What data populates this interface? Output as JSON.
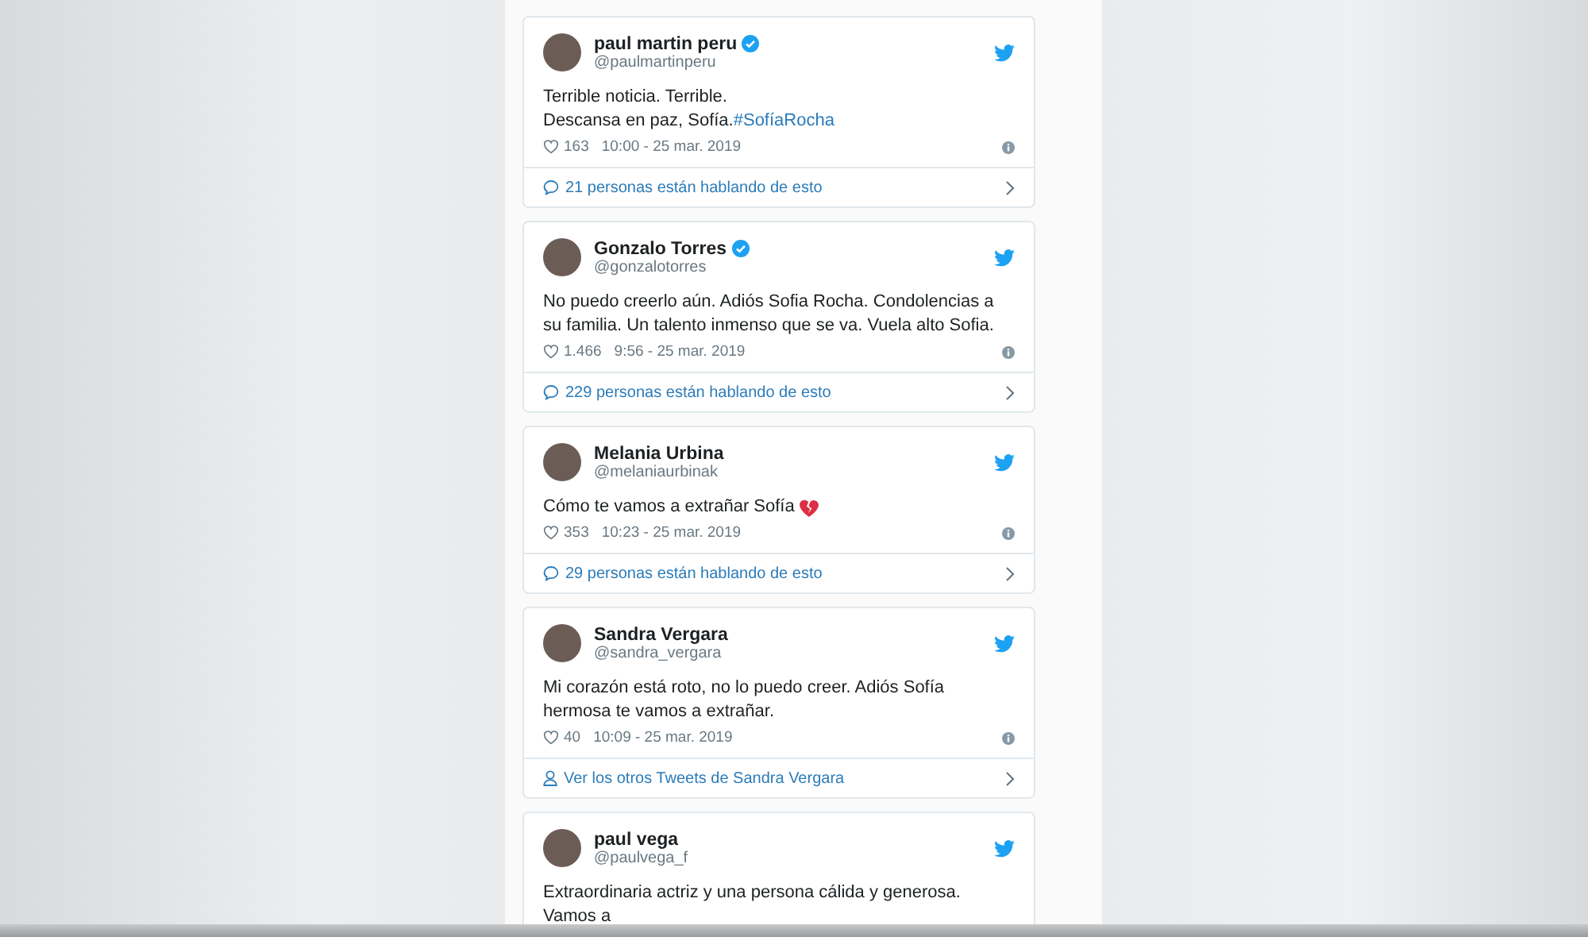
{
  "tweets": [
    {
      "name": "paul martin peru",
      "handle": "@paulmartinperu",
      "verified": true,
      "lines": [
        "Terrible noticia. Terrible.",
        "Descansa en paz, Sofía."
      ],
      "hashtag": "#SofíaRocha",
      "emoji": false,
      "likes": "163",
      "time": "10:00 - 25 mar. 2019",
      "footer": {
        "kind": "conversation",
        "text": "21 personas están hablando de esto"
      }
    },
    {
      "name": "Gonzalo Torres",
      "handle": "@gonzalotorres",
      "verified": true,
      "lines": [
        "No puedo creerlo aún. Adiós Sofia Rocha. Condolencias a su familia. Un talento inmenso que se va. Vuela alto Sofia."
      ],
      "emoji": false,
      "likes": "1.466",
      "time": "9:56 - 25 mar. 2019",
      "footer": {
        "kind": "conversation",
        "text": "229 personas están hablando de esto"
      }
    },
    {
      "name": "Melania Urbina",
      "handle": "@melaniaurbinak",
      "verified": false,
      "lines": [
        "Cómo te vamos a extrañar Sofía"
      ],
      "emoji": true,
      "likes": "353",
      "time": "10:23 - 25 mar. 2019",
      "footer": {
        "kind": "conversation",
        "text": "29 personas están hablando de esto"
      }
    },
    {
      "name": "Sandra Vergara",
      "handle": "@sandra_vergara",
      "verified": false,
      "lines": [
        "Mi corazón está roto, no lo puedo creer. Adiós Sofía hermosa te vamos a extrañar."
      ],
      "emoji": false,
      "likes": "40",
      "time": "10:09 - 25 mar. 2019",
      "footer": {
        "kind": "profile",
        "text": "Ver los otros Tweets de Sandra Vergara"
      }
    },
    {
      "name": "paul vega",
      "handle": "@paulvega_f",
      "verified": false,
      "lines": [
        "Extraordinaria actriz y una persona cálida y generosa. Vamos a"
      ],
      "emoji": false
    }
  ]
}
